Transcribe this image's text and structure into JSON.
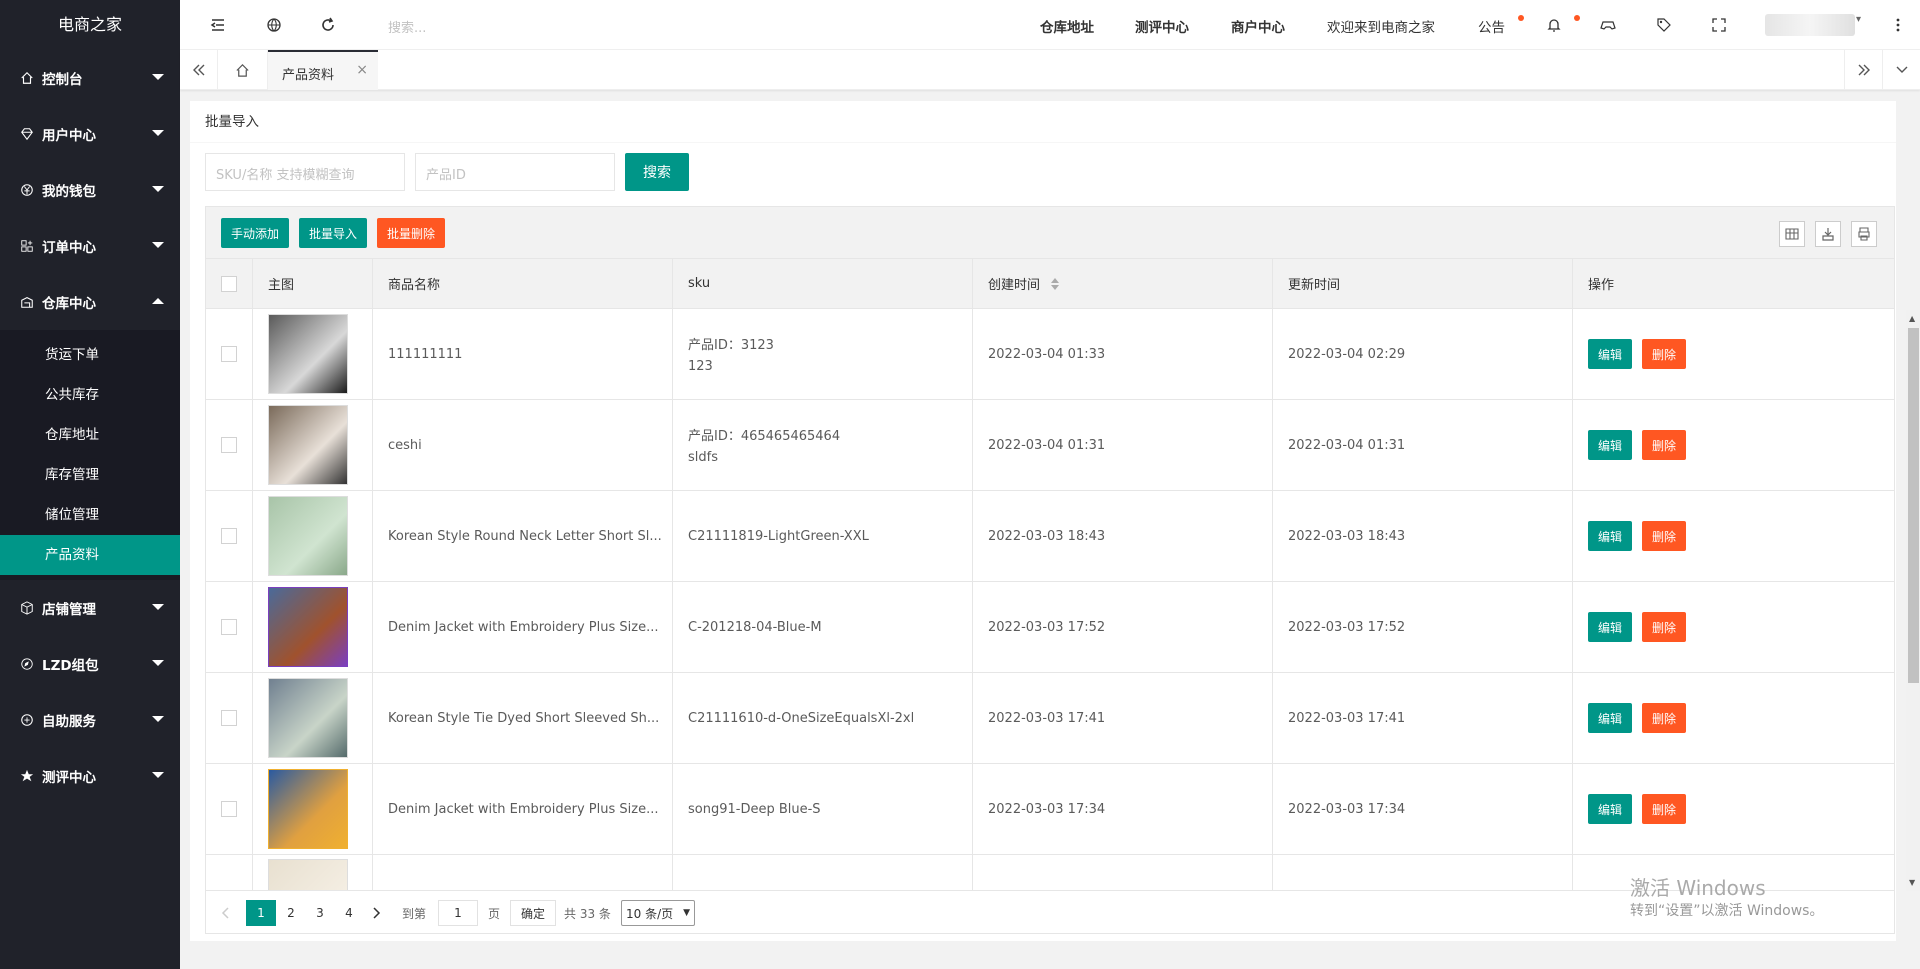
{
  "app": {
    "title": "电商之家"
  },
  "sidebar": {
    "items": [
      {
        "label": "控制台",
        "icon": "home-icon"
      },
      {
        "label": "用户中心",
        "icon": "diamond-icon"
      },
      {
        "label": "我的钱包",
        "icon": "yen-icon"
      },
      {
        "label": "订单中心",
        "icon": "apps-icon"
      },
      {
        "label": "仓库中心",
        "icon": "warehouse-icon",
        "expanded": true
      },
      {
        "label": "店铺管理",
        "icon": "cube-icon"
      },
      {
        "label": "LZD组包",
        "icon": "compass-icon"
      },
      {
        "label": "自助服务",
        "icon": "service-icon"
      },
      {
        "label": "测评中心",
        "icon": "star-icon"
      }
    ],
    "sub_items": [
      "货运下单",
      "公共库存",
      "仓库地址",
      "库存管理",
      "储位管理",
      "产品资料"
    ],
    "active_sub": "产品资料"
  },
  "topbar": {
    "search_placeholder": "搜索...",
    "links": [
      "仓库地址",
      "测评中心",
      "商户中心"
    ],
    "welcome": "欢迎来到电商之家",
    "notice": "公告"
  },
  "tabs": {
    "active": "产品资料",
    "close": "×"
  },
  "card": {
    "header": "批量导入"
  },
  "search": {
    "sku_placeholder": "SKU/名称 支持模糊查询",
    "id_placeholder": "产品ID",
    "button": "搜索"
  },
  "toolbar": {
    "add": "手动添加",
    "import": "批量导入",
    "delete": "批量删除"
  },
  "table": {
    "headers": [
      "主图",
      "商品名称",
      "sku",
      "创建时间",
      "更新时间",
      "操作"
    ],
    "edit_label": "编辑",
    "delete_label": "删除",
    "rows": [
      {
        "name": "111111111",
        "sku1": "产品ID：3123",
        "sku2": "123",
        "created": "2022-03-04 01:33",
        "updated": "2022-03-04 02:29"
      },
      {
        "name": "ceshi",
        "sku1": "产品ID：465465465464",
        "sku2": "sldfs",
        "created": "2022-03-04 01:31",
        "updated": "2022-03-04 01:31"
      },
      {
        "name": "Korean Style Round Neck Letter Short Sl...",
        "sku1": "C21111819-LightGreen-XXL",
        "sku2": "",
        "created": "2022-03-03 18:43",
        "updated": "2022-03-03 18:43"
      },
      {
        "name": "Denim Jacket with Embroidery Plus Size...",
        "sku1": "C-201218-04-Blue-M",
        "sku2": "",
        "created": "2022-03-03 17:52",
        "updated": "2022-03-03 17:52"
      },
      {
        "name": "Korean Style Tie Dyed Short Sleeved Sh...",
        "sku1": "C21111610-d-OneSizeEqualsXl-2xl",
        "sku2": "",
        "created": "2022-03-03 17:41",
        "updated": "2022-03-03 17:41"
      },
      {
        "name": "Denim Jacket with Embroidery Plus Size...",
        "sku1": "song91-Deep Blue-S",
        "sku2": "",
        "created": "2022-03-03 17:34",
        "updated": "2022-03-03 17:34"
      }
    ]
  },
  "pagination": {
    "pages": [
      "1",
      "2",
      "3",
      "4"
    ],
    "current": "1",
    "goto_label": "到第",
    "goto_value": "1",
    "page_unit": "页",
    "confirm": "确定",
    "total": "共 33 条",
    "per_page": "10 条/页"
  },
  "watermark": {
    "line1": "激活 Windows",
    "line2": "转到“设置”以激活 Windows。"
  },
  "colors": {
    "accent": "#009688",
    "danger": "#ff5722",
    "sidebar": "#20222a"
  }
}
